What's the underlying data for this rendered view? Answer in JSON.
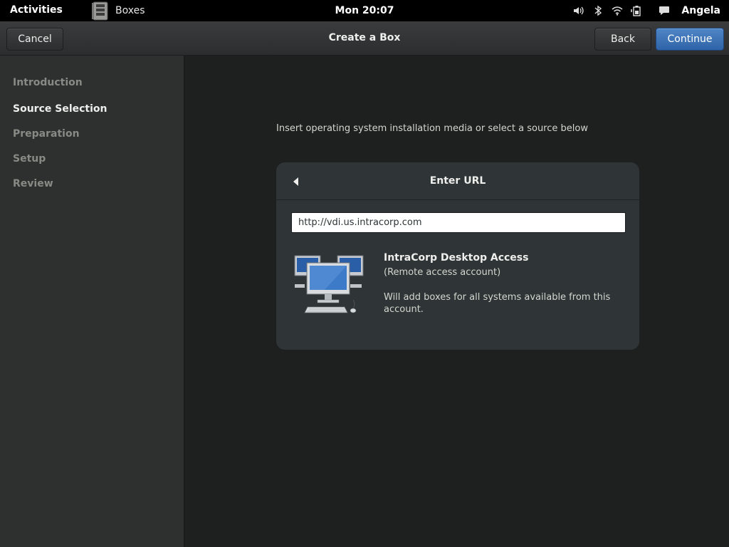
{
  "topbar": {
    "activities": "Activities",
    "app_name": "Boxes",
    "clock": "Mon 20:07",
    "user_name": "Angela",
    "tray_icons": [
      "volume-icon",
      "bluetooth-icon",
      "wifi-icon",
      "battery-icon",
      "chat-icon"
    ]
  },
  "header": {
    "title": "Create a Box",
    "cancel_label": "Cancel",
    "back_label": "Back",
    "continue_label": "Continue"
  },
  "sidebar": {
    "steps": [
      {
        "label": "Introduction",
        "active": false
      },
      {
        "label": "Source Selection",
        "active": true
      },
      {
        "label": "Preparation",
        "active": false
      },
      {
        "label": "Setup",
        "active": false
      },
      {
        "label": "Review",
        "active": false
      }
    ]
  },
  "main": {
    "hint": "Insert operating system installation media or select a source below",
    "panel": {
      "title": "Enter URL",
      "url_value": "http://vdi.us.intracorp.com",
      "source": {
        "name": "IntraCorp Desktop Access",
        "type": "(Remote access account)",
        "description": "Will add boxes for all systems available from this account."
      }
    }
  },
  "colors": {
    "accent": "#3a72bb",
    "sidebar_bg": "#2e3030",
    "main_bg": "#1e1f1f",
    "panel_bg": "#2f3436"
  }
}
